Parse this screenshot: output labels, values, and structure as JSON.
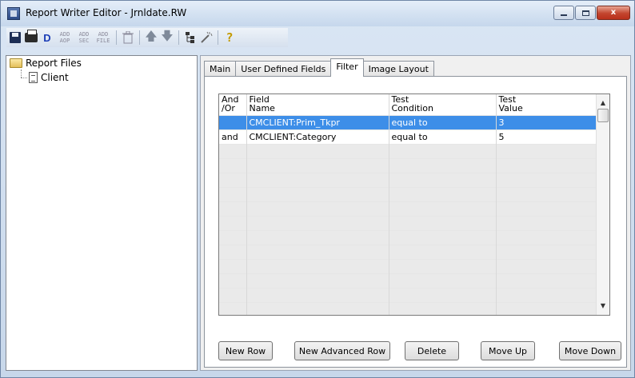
{
  "window": {
    "title": "Report Writer Editor - Jrnldate.RW",
    "min_label": "",
    "max_label": "",
    "close_label": "x"
  },
  "toolbar": {
    "items": [
      {
        "name": "save",
        "icon": "save-icon"
      },
      {
        "name": "print",
        "icon": "printer-icon"
      },
      {
        "name": "d",
        "label": "D"
      },
      {
        "name": "add-aop",
        "line1": "ADD",
        "line2": "AOP"
      },
      {
        "name": "add-sec",
        "line1": "ADD",
        "line2": "SEC"
      },
      {
        "name": "add-file",
        "line1": "ADD",
        "line2": "FILE"
      },
      {
        "name": "delete",
        "icon": "trash-icon"
      },
      {
        "name": "move-up",
        "icon": "arrow-up-icon"
      },
      {
        "name": "move-down",
        "icon": "arrow-down-icon"
      },
      {
        "name": "tree",
        "icon": "tree-icon"
      },
      {
        "name": "wizard",
        "icon": "wand-icon"
      },
      {
        "name": "help",
        "label": "?"
      }
    ]
  },
  "tree": {
    "root_label": "Report Files",
    "child_label": "Client"
  },
  "tabs": [
    {
      "label": "Main",
      "active": false
    },
    {
      "label": "User Defined Fields",
      "active": false
    },
    {
      "label": "Filter",
      "active": true
    },
    {
      "label": "Image Layout",
      "active": false
    }
  ],
  "grid": {
    "columns": [
      {
        "line1": "And",
        "line2": "/Or"
      },
      {
        "line1": "Field",
        "line2": "Name"
      },
      {
        "line1": "Test",
        "line2": "Condition"
      },
      {
        "line1": "Test",
        "line2": "Value"
      }
    ],
    "rows": [
      {
        "and_or": "",
        "field": "CMCLIENT:Prim_Tkpr",
        "condition": "equal to",
        "value": "3",
        "selected": true
      },
      {
        "and_or": "and",
        "field": "CMCLIENT:Category",
        "condition": "equal to",
        "value": "5",
        "selected": false
      }
    ],
    "blank_rows": 12
  },
  "buttons": {
    "new_row": "New Row",
    "new_advanced_row": "New Advanced Row",
    "delete": "Delete",
    "move_up": "Move Up",
    "move_down": "Move Down"
  },
  "colors": {
    "selection": "#3d8ee8",
    "blank_row": "#eaeaea"
  }
}
